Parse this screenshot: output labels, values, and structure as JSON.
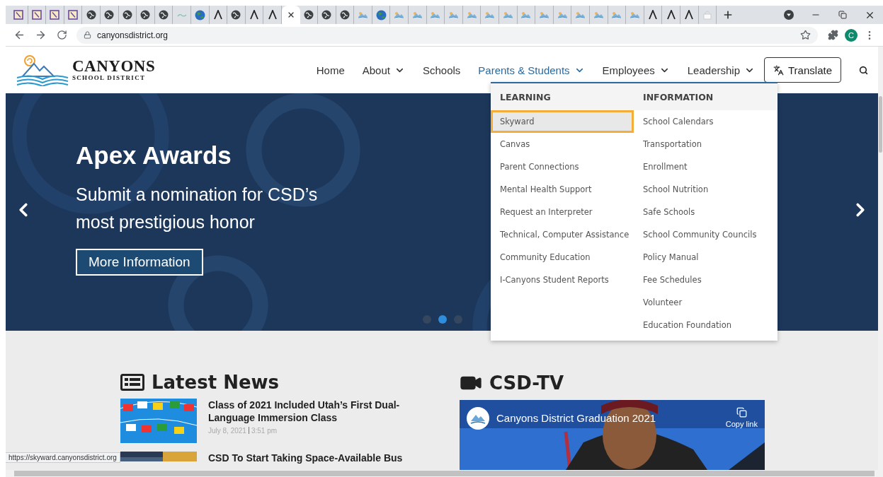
{
  "browser": {
    "tabs": [
      {
        "kind": "notebook",
        "selected": false
      },
      {
        "kind": "notebook",
        "selected": false
      },
      {
        "kind": "notebook",
        "selected": false
      },
      {
        "kind": "notebook",
        "selected": false
      },
      {
        "kind": "globe",
        "selected": false
      },
      {
        "kind": "globe",
        "selected": false
      },
      {
        "kind": "globe",
        "selected": false
      },
      {
        "kind": "globe",
        "selected": false
      },
      {
        "kind": "globe",
        "selected": false
      },
      {
        "kind": "wave",
        "selected": false
      },
      {
        "kind": "earth",
        "selected": false
      },
      {
        "kind": "lambda",
        "selected": false
      },
      {
        "kind": "globe",
        "selected": false
      },
      {
        "kind": "lambda",
        "selected": false
      },
      {
        "kind": "lambda",
        "selected": false
      },
      {
        "kind": "close",
        "selected": true
      },
      {
        "kind": "globe",
        "selected": false
      },
      {
        "kind": "globe",
        "selected": false
      },
      {
        "kind": "globe",
        "selected": false
      },
      {
        "kind": "mountain",
        "selected": false
      },
      {
        "kind": "earth",
        "selected": false
      },
      {
        "kind": "mountain",
        "selected": false
      },
      {
        "kind": "mountain",
        "selected": false
      },
      {
        "kind": "mountain",
        "selected": false
      },
      {
        "kind": "mountain",
        "selected": false
      },
      {
        "kind": "mountain",
        "selected": false
      },
      {
        "kind": "mountain",
        "selected": false
      },
      {
        "kind": "mountain",
        "selected": false
      },
      {
        "kind": "mountain",
        "selected": false
      },
      {
        "kind": "mountain",
        "selected": false
      },
      {
        "kind": "mountain",
        "selected": false
      },
      {
        "kind": "mountain",
        "selected": false
      },
      {
        "kind": "mountain",
        "selected": false
      },
      {
        "kind": "mountain",
        "selected": false
      },
      {
        "kind": "mountain",
        "selected": false
      },
      {
        "kind": "lambda",
        "selected": false
      },
      {
        "kind": "lambda",
        "selected": false
      },
      {
        "kind": "lambda",
        "selected": false
      },
      {
        "kind": "lock",
        "selected": false
      }
    ],
    "address": "canyonsdistrict.org",
    "profile_initial": "C"
  },
  "site": {
    "logo": {
      "name": "CANYONS",
      "subtitle": "SCHOOL DISTRICT"
    },
    "nav": [
      {
        "label": "Home",
        "has_menu": false,
        "selected": false
      },
      {
        "label": "About",
        "has_menu": true,
        "selected": false
      },
      {
        "label": "Schools",
        "has_menu": false,
        "selected": false
      },
      {
        "label": "Parents & Students",
        "has_menu": true,
        "selected": true
      },
      {
        "label": "Employees",
        "has_menu": true,
        "selected": false
      },
      {
        "label": "Leadership",
        "has_menu": true,
        "selected": false
      }
    ],
    "translate": "Translate"
  },
  "hero": {
    "title": "Apex Awards",
    "subtitle": "Submit a nomination for CSD’s most prestigious honor",
    "button": "More Information",
    "dots": [
      {
        "selected": false
      },
      {
        "selected": true
      },
      {
        "selected": false
      }
    ]
  },
  "dropdown": {
    "columns": [
      {
        "heading": "LEARNING",
        "items": [
          {
            "label": "Skyward",
            "selected": true
          },
          {
            "label": "Canvas",
            "selected": false
          },
          {
            "label": "Parent Connections",
            "selected": false
          },
          {
            "label": "Mental Health Support",
            "selected": false
          },
          {
            "label": "Request an Interpreter",
            "selected": false
          },
          {
            "label": "Technical, Computer Assistance",
            "selected": false
          },
          {
            "label": "Community Education",
            "selected": false
          },
          {
            "label": "I-Canyons Student Reports",
            "selected": false
          }
        ]
      },
      {
        "heading": "INFORMATION",
        "items": [
          {
            "label": "School Calendars",
            "selected": false
          },
          {
            "label": "Transportation",
            "selected": false
          },
          {
            "label": "Enrollment",
            "selected": false
          },
          {
            "label": "School Nutrition",
            "selected": false
          },
          {
            "label": "Safe Schools",
            "selected": false
          },
          {
            "label": "School Community Councils",
            "selected": false
          },
          {
            "label": "Policy Manual",
            "selected": false
          },
          {
            "label": "Fee Schedules",
            "selected": false
          },
          {
            "label": "Volunteer",
            "selected": false
          },
          {
            "label": "Education Foundation",
            "selected": false
          }
        ]
      }
    ]
  },
  "news": {
    "heading": "Latest News",
    "items": [
      {
        "title": "Class of 2021 Included Utah’s First Dual-Language Immersion Class",
        "date": "July 8, 2021",
        "time": "3:51 pm"
      },
      {
        "title": "CSD To Start Taking Space-Available Bus"
      }
    ]
  },
  "tv": {
    "heading": "CSD-TV",
    "video_title": "Canyons District Graduation 2021",
    "copy_link": "Copy link"
  },
  "status_bar": "https://skyward.canyonsdistrict.org"
}
